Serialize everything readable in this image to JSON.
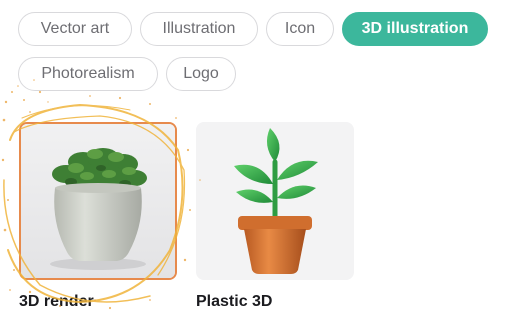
{
  "style_filters": {
    "row1": [
      {
        "label": "Vector art",
        "active": false
      },
      {
        "label": "Illustration",
        "active": false
      },
      {
        "label": "Icon",
        "active": false
      },
      {
        "label": "3D illustration",
        "active": true
      }
    ],
    "row2": [
      {
        "label": "Photorealism",
        "active": false
      },
      {
        "label": "Logo",
        "active": false
      }
    ]
  },
  "style_options": [
    {
      "caption": "3D render",
      "selected": true,
      "image": "potted-plant-photo"
    },
    {
      "caption": "Plastic 3D",
      "selected": false,
      "image": "plastic-plant-icon"
    }
  ],
  "colors": {
    "accent": "#3cb79c",
    "selection_border": "#e78a4c",
    "chip_border": "#d9d9dc",
    "chip_text": "#6e6e73",
    "sparkle": "#f0b43c"
  }
}
